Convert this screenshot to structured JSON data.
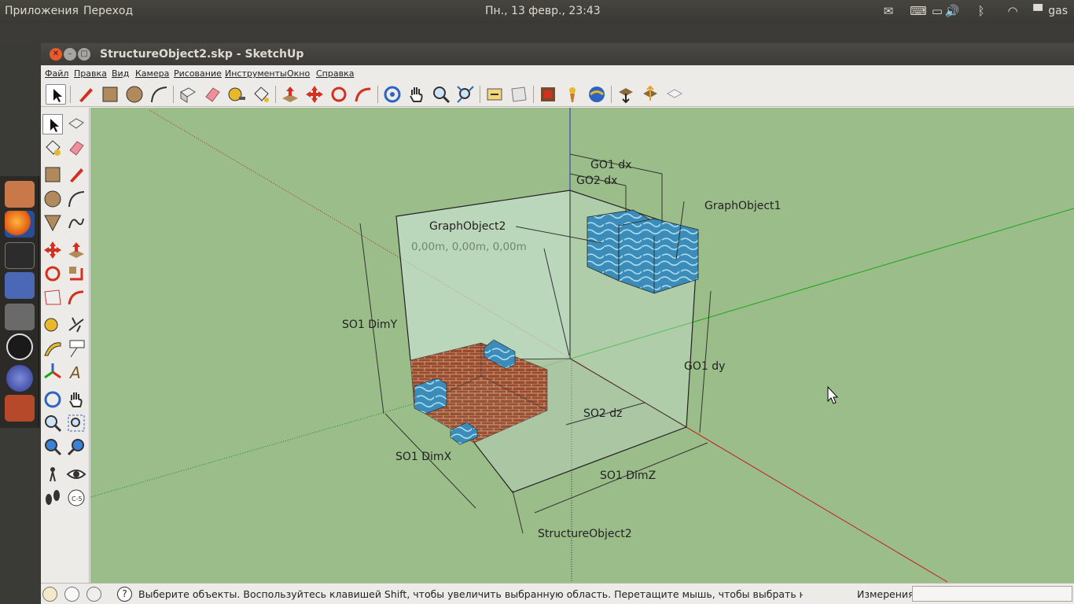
{
  "topbar": {
    "apps_menu": "Приложения",
    "places_menu": "Переход",
    "clock": "Пн., 13 февр., 23:43",
    "user": "gas"
  },
  "window": {
    "title": "StructureObject2.skp - SketchUp"
  },
  "menu": [
    "Файл",
    "Правка",
    "Вид",
    "Камера",
    "Рисование",
    "Инструменты",
    "Окно",
    "Справка"
  ],
  "viewport": {
    "labels": {
      "go1_dx": "GO1 dx",
      "go2_dx": "GO2 dx",
      "graph_object_1": "GraphObject1",
      "graph_object_2": "GraphObject2",
      "origin_coords": "0,00m, 0,00m, 0,00m",
      "so1_dimy": "SO1 DimY",
      "go1_dy": "GO1 dy",
      "so2_dz": "SO2 dz",
      "so1_dimx": "SO1 DimX",
      "so1_dimz": "SO1 DimZ",
      "structure_object_2": "StructureObject2"
    },
    "colors": {
      "background": "#9bbd89",
      "red_axis": "#c41d1d",
      "green_axis": "#1aa61a",
      "blue_axis": "#2b2bd0"
    }
  },
  "status": {
    "message": "Выберите объекты. Воспользуйтесь клавишей Shift, чтобы увеличить выбранную область. Перетащите мышь, чтобы выбрать несколько объь",
    "measurements_label": "Измерения",
    "measurements_value": ""
  }
}
